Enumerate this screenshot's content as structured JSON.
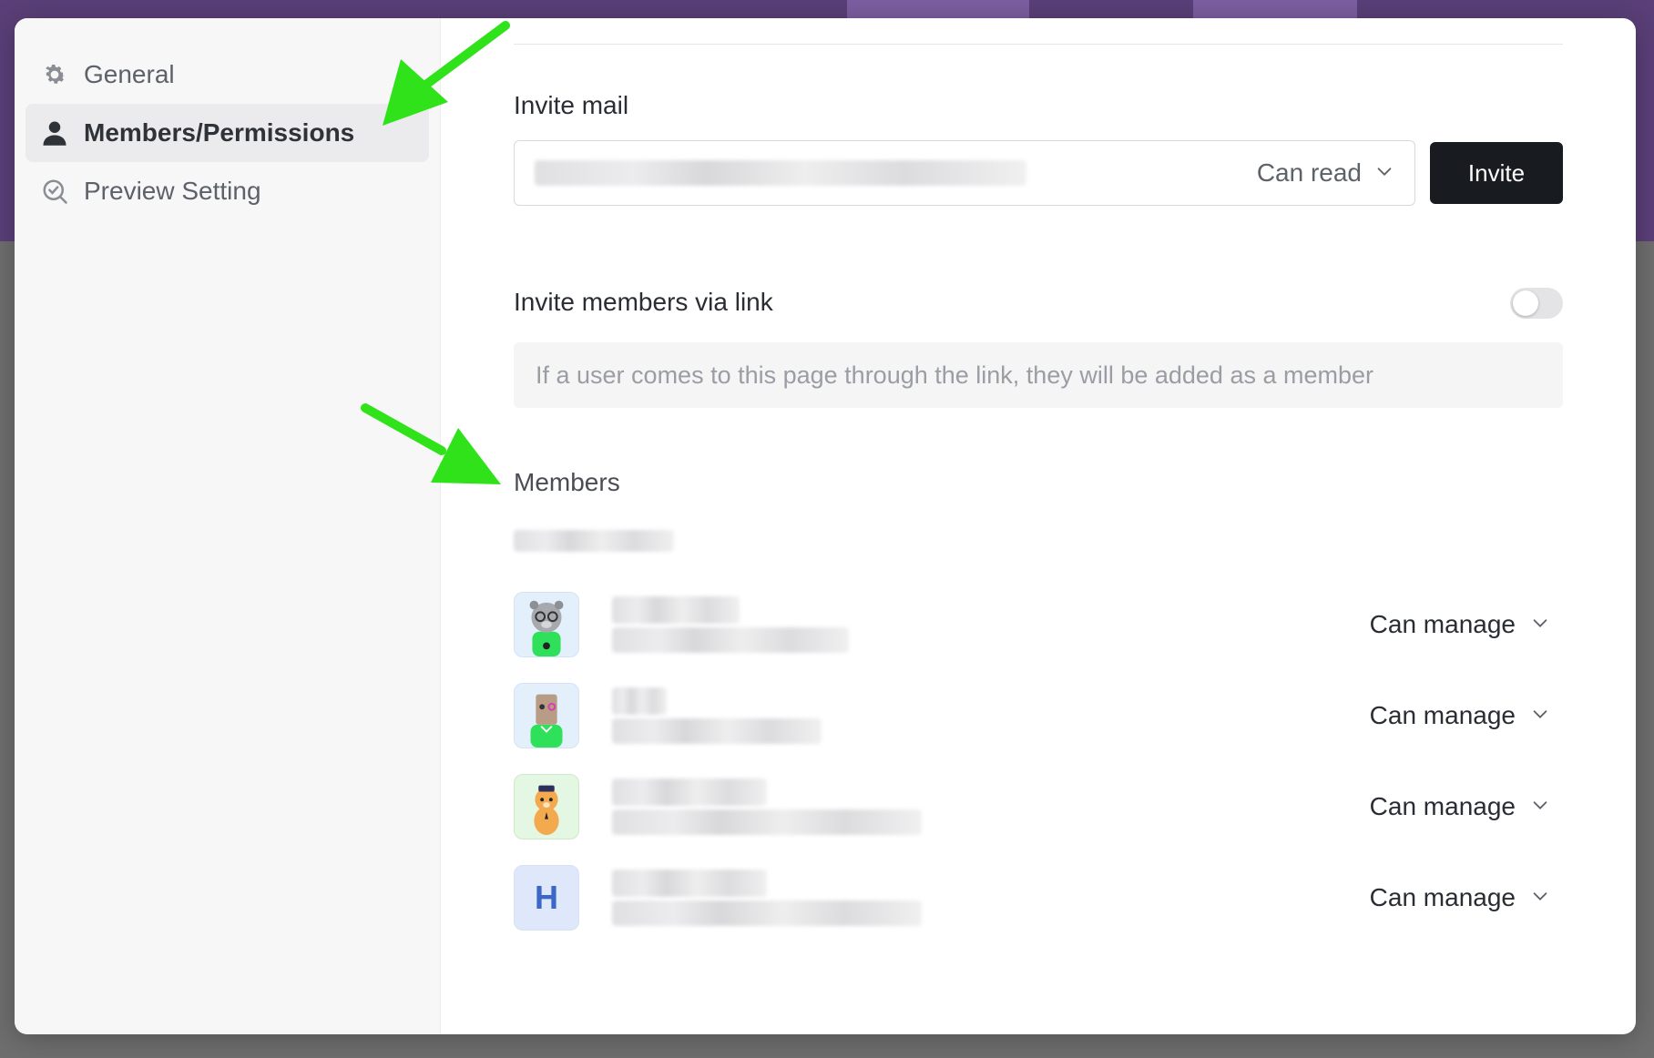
{
  "sidebar": {
    "items": [
      {
        "label": "General",
        "icon": "gear-icon"
      },
      {
        "label": "Members/Permissions",
        "icon": "person-icon"
      },
      {
        "label": "Preview Setting",
        "icon": "preview-check-icon"
      }
    ]
  },
  "invite": {
    "title": "Invite mail",
    "role": "Can read",
    "button_label": "Invite"
  },
  "link": {
    "title": "Invite members via link",
    "enabled": false,
    "description": "If a user comes to this page through the link, they will be added as a member"
  },
  "members": {
    "title": "Members",
    "list": [
      {
        "avatar": "bear-avatar",
        "permission": "Can manage"
      },
      {
        "avatar": "paperbag-avatar",
        "permission": "Can manage"
      },
      {
        "avatar": "dog-avatar",
        "permission": "Can manage"
      },
      {
        "avatar": "letter-avatar",
        "initial": "H",
        "permission": "Can manage"
      }
    ]
  },
  "colors": {
    "primary_button": "#181b20",
    "annotation_arrow": "#2fe21a",
    "letter_avatar_bg": "#dfe7fb",
    "letter_avatar_fg": "#3d66c9"
  }
}
